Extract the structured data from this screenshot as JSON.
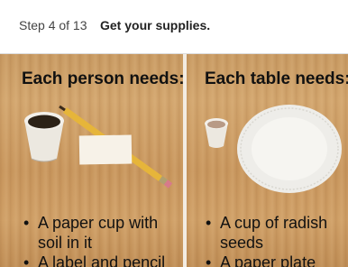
{
  "header": {
    "step": "Step 4 of 13",
    "title": "Get your supplies."
  },
  "panels": [
    {
      "heading": "Each person needs:",
      "items": [
        "A paper cup with soil in it",
        "A label and pencil"
      ]
    },
    {
      "heading": "Each table needs:",
      "items": [
        "A cup of radish seeds",
        "A paper plate"
      ]
    }
  ]
}
